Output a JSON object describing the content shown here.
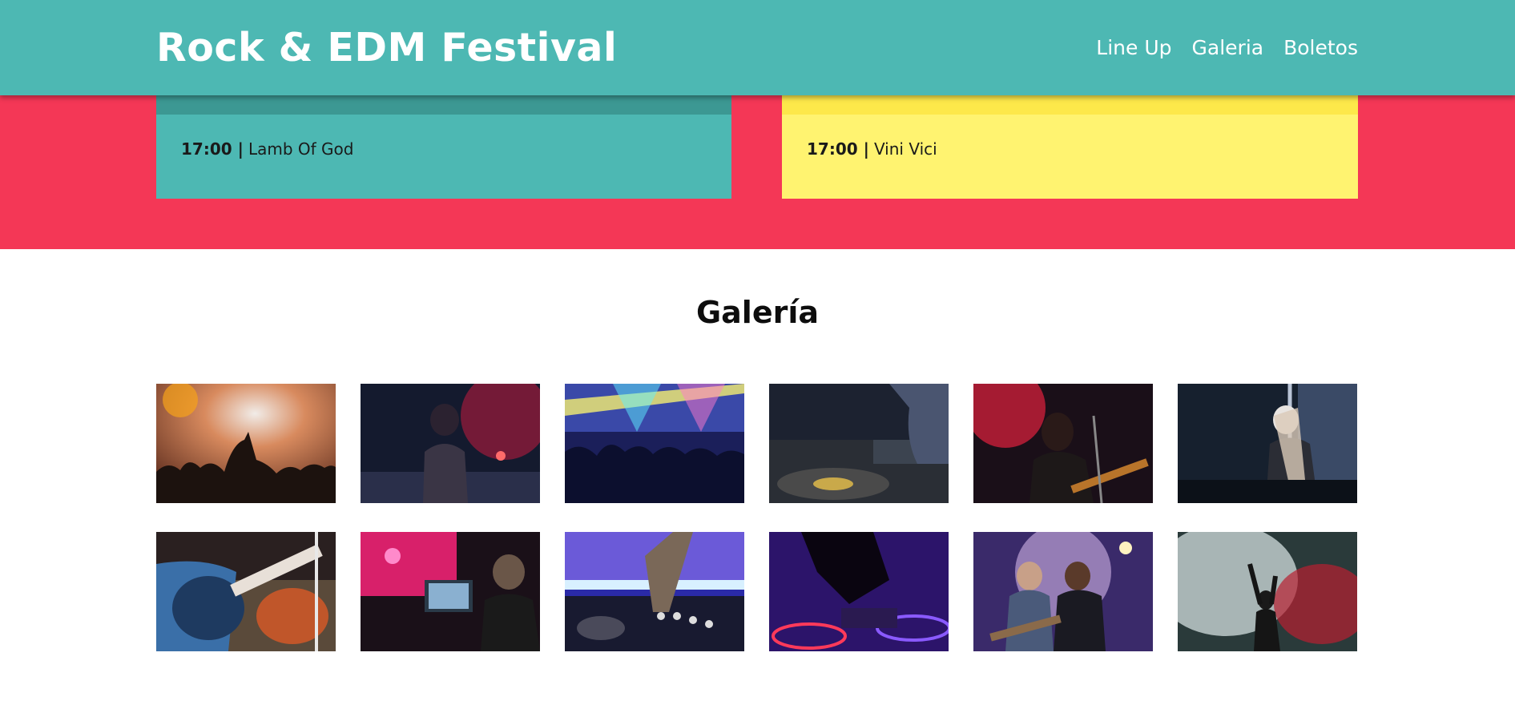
{
  "header": {
    "title": "Rock & EDM Festival",
    "nav": [
      "Line Up",
      "Galeria",
      "Boletos"
    ]
  },
  "lineup": {
    "rock": {
      "time": "17:00 |",
      "artist": "Lamb Of God"
    },
    "edm": {
      "time": "17:00 |",
      "artist": "Vini Vici"
    }
  },
  "gallery": {
    "title": "Galería",
    "photos": [
      "crowd-photo",
      "singer-photo",
      "stage-lights-photo",
      "dj-turntable-photo",
      "guitarist-photo",
      "female-dj-photo",
      "guitar-hands-photo",
      "dj-laptop-photo",
      "dj-mixer-photo",
      "dj-decks-photo",
      "rock-duo-photo",
      "smoke-performer-photo"
    ]
  },
  "colors": {
    "header": "#4db8b3",
    "lineup_band": "#f43756",
    "rock_slot": "#4db8b3",
    "edm_slot": "#fff370"
  }
}
